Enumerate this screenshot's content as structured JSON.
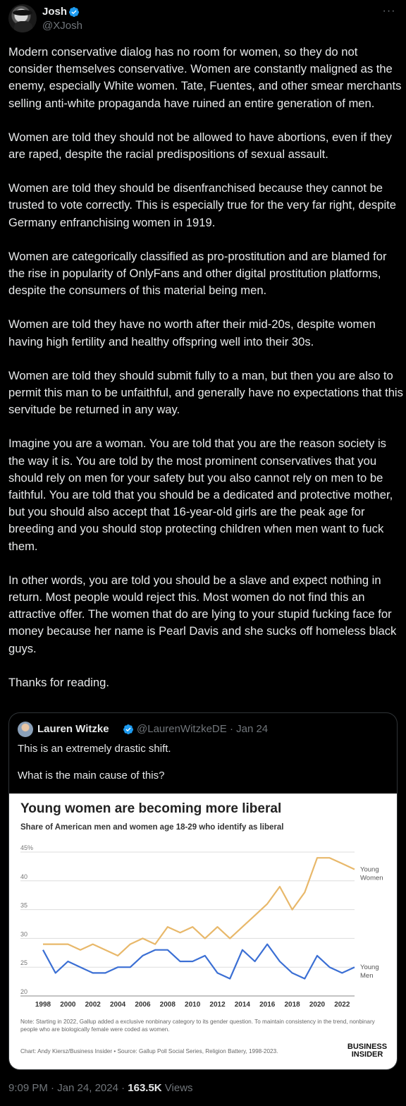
{
  "author": {
    "name": "Josh",
    "handle": "@XJosh"
  },
  "more_icon": "more-horizontal-icon",
  "paragraphs": [
    "Modern conservative dialog has no room for women, so they do not consider themselves conservative. Women are constantly maligned as the enemy, especially White women. Tate, Fuentes, and other smear merchants selling anti-white propaganda have ruined an entire generation of men.",
    "Women are told they should not be allowed to have abortions, even if they are raped, despite the racial predispositions of sexual assault.",
    "Women are told they should be disenfranchised because they cannot be trusted to vote correctly. This is especially true for the very far right, despite Germany enfranchising women in 1919.",
    "Women are categorically classified as pro-prostitution and are blamed for the rise in popularity of OnlyFans and other digital prostitution platforms, despite the consumers of this material being men.",
    "Women are told they have no worth after their mid-20s, despite women having high fertility and healthy offspring well into their 30s.",
    "Women are told they should submit fully to a man, but then you are also to permit this man to be unfaithful, and generally have no expectations that this servitude be returned in any way.",
    "Imagine you are a woman. You are told that you are the reason society is the way it is. You are told by the most prominent conservatives that you should rely on men for your safety but you also cannot rely on men to be faithful. You are told that you should be a dedicated and protective mother, but you should also accept that 16-year-old girls are the peak age for breeding and you should stop protecting children when men want to fuck them.",
    "In other words, you are told you should be a slave and expect nothing in return. Most people would reject this. Most women do not find this an attractive offer. The women that do are lying to your stupid fucking face for money because her name  is Pearl Davis and she sucks off homeless black guys.",
    "Thanks for reading."
  ],
  "quote": {
    "name": "Lauren Witzke",
    "handle": "@LaurenWitzkeDE · Jan 24",
    "lines": [
      "This is an extremely drastic shift.",
      "What is the main cause of this?"
    ]
  },
  "chart_data": {
    "type": "line",
    "title": "Young women are becoming more liberal",
    "subtitle": "Share of American men and women age 18-29 who identify as liberal",
    "ylim": [
      20,
      45
    ],
    "yticks": [
      "20",
      "25",
      "30",
      "35",
      "40",
      "45%"
    ],
    "xticks": [
      "1998",
      "2000",
      "2002",
      "2004",
      "2006",
      "2008",
      "2010",
      "2012",
      "2014",
      "2016",
      "2018",
      "2020",
      "2022"
    ],
    "x": [
      1998,
      1999,
      2000,
      2001,
      2002,
      2003,
      2004,
      2005,
      2006,
      2007,
      2008,
      2009,
      2010,
      2011,
      2012,
      2013,
      2014,
      2015,
      2016,
      2017,
      2018,
      2019,
      2020,
      2021,
      2022,
      2023
    ],
    "series": [
      {
        "name": "Young Women",
        "label_lines": [
          "Young",
          "Women"
        ],
        "color": "#e8b86a",
        "values": [
          29,
          29,
          29,
          28,
          29,
          28,
          27,
          29,
          30,
          29,
          32,
          31,
          32,
          30,
          32,
          30,
          32,
          34,
          36,
          39,
          35,
          38,
          44,
          44,
          43,
          42
        ]
      },
      {
        "name": "Young Men",
        "label_lines": [
          "Young",
          "Men"
        ],
        "color": "#3b6fd4",
        "values": [
          28,
          24,
          26,
          25,
          24,
          24,
          25,
          25,
          27,
          28,
          28,
          26,
          26,
          27,
          24,
          23,
          28,
          26,
          29,
          26,
          24,
          23,
          27,
          25,
          24,
          25
        ]
      }
    ],
    "grid": true,
    "note": "Note: Starting in 2022, Gallup added a exclusive nonbinary category to its gender question. To maintain consistency in the trend, nonbinary people who are biologically female were coded as women.",
    "source": "Chart: Andy Kiersz/Business Insider • Source: Gallup Poll Social Series, Religion Battery, 1998-2023.",
    "brand_lines": [
      "BUSINESS",
      "INSIDER"
    ]
  },
  "footer": {
    "timestamp": "9:09 PM · Jan 24, 2024 · ",
    "views_count": "163.5K",
    "views_label": " Views"
  },
  "colors": {
    "verified": "#1d9bf0",
    "muted": "#71767b",
    "border": "#2f3336"
  }
}
